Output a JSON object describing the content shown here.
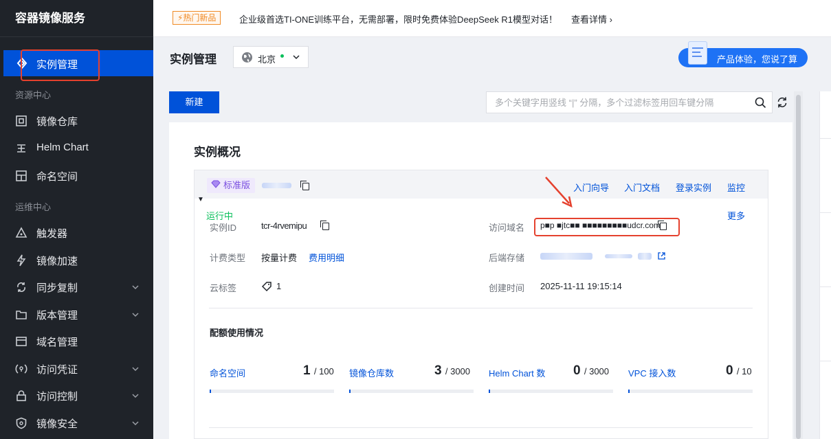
{
  "app": {
    "title": "容器镜像服务"
  },
  "sidebar": {
    "active_label": "实例管理",
    "group_resource": "资源中心",
    "group_ops": "运维中心",
    "items": [
      {
        "label": "镜像仓库",
        "icon": "repository-icon"
      },
      {
        "label": "Helm Chart",
        "icon": "helm-icon"
      },
      {
        "label": "命名空间",
        "icon": "namespace-icon"
      },
      {
        "label": "触发器",
        "icon": "trigger-icon"
      },
      {
        "label": "镜像加速",
        "icon": "lightning-icon"
      },
      {
        "label": "同步复制",
        "icon": "sync-icon"
      },
      {
        "label": "版本管理",
        "icon": "folder-icon"
      },
      {
        "label": "域名管理",
        "icon": "domain-icon"
      },
      {
        "label": "访问凭证",
        "icon": "credential-icon"
      },
      {
        "label": "访问控制",
        "icon": "lock-icon"
      },
      {
        "label": "镜像安全",
        "icon": "shield-icon"
      }
    ]
  },
  "banner": {
    "tag": "⚡热门新品",
    "text": "企业级首选TI-ONE训练平台，无需部署，限时免费体验DeepSeek R1模型对话！",
    "link": "查看详情 ›"
  },
  "header": {
    "title": "实例管理",
    "region": "北京",
    "feedback": "产品体验，您说了算"
  },
  "toolbar": {
    "new_label": "新建",
    "search_placeholder": "多个关键字用竖线 “|” 分隔，多个过滤标签用回车键分隔"
  },
  "overview": {
    "title": "实例概况",
    "edition": "标准版",
    "links": [
      "入门向导",
      "入门文档",
      "登录实例",
      "监控"
    ],
    "status": "运行中",
    "more": "更多",
    "fields": {
      "instance_id_label": "实例ID",
      "instance_id_value": "tcr-4rvemipu",
      "domain_label": "访问域名",
      "domain_value": "p■p  ■jtc■■ ■■■■■■■■■udcr.com",
      "billing_label": "计费类型",
      "billing_value": "按量计费",
      "billing_link": "费用明细",
      "storage_label": "后端存储",
      "tag_label": "云标签",
      "tag_count": "1",
      "created_label": "创建时间",
      "created_value": "2025-11-11 19:15:14"
    }
  },
  "quota": {
    "title": "配额使用情况",
    "items": [
      {
        "label": "命名空间",
        "used": "1",
        "total": "/ 100",
        "usage_fraction": 0.01
      },
      {
        "label": "镜像仓库数",
        "used": "3",
        "total": "/ 3000",
        "usage_fraction": 0.001
      },
      {
        "label": "Helm Chart 数",
        "used": "0",
        "total": "/ 3000",
        "usage_fraction": 0
      },
      {
        "label": "VPC 接入数",
        "used": "0",
        "total": "/ 10",
        "usage_fraction": 0
      }
    ]
  },
  "colors": {
    "primary": "#0052d9",
    "sidebar_bg": "#1f2329",
    "success": "#0abf5b",
    "annotation": "#e5412e",
    "hot": "#f08a24"
  }
}
